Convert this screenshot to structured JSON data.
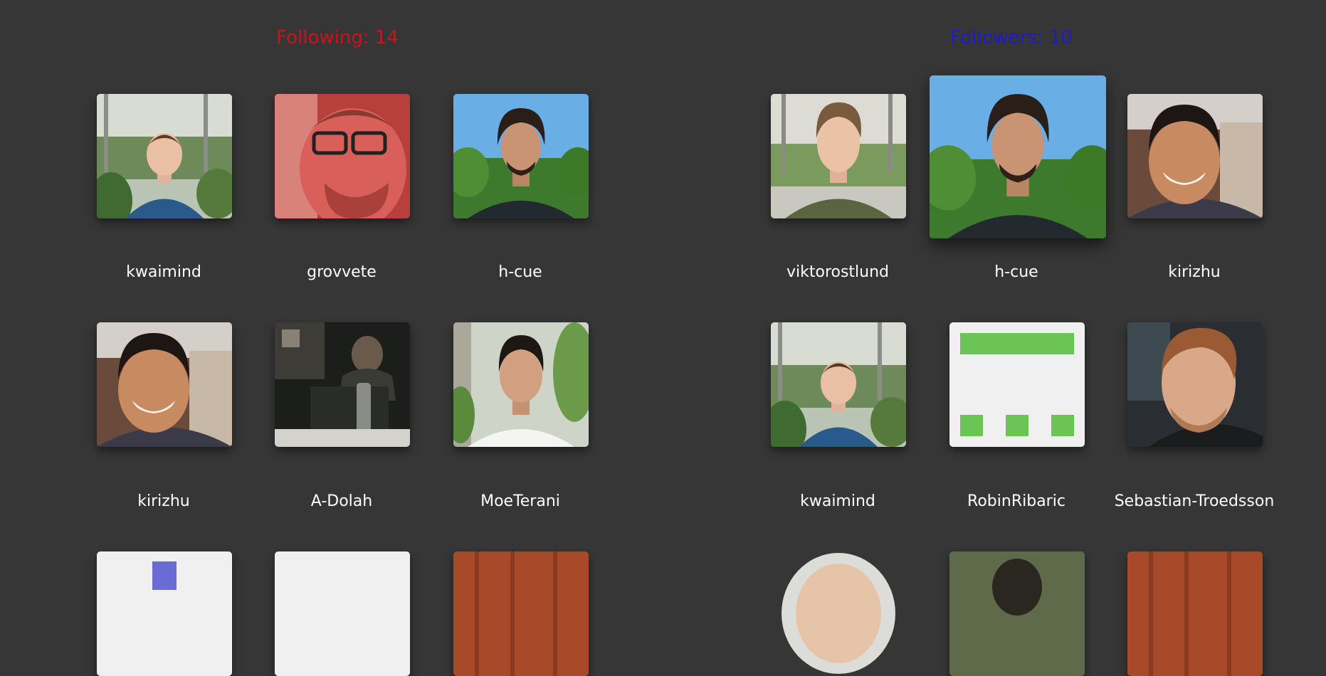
{
  "following": {
    "title": "Following: 14",
    "users": [
      {
        "username": "kwaimind",
        "avatar": "photo"
      },
      {
        "username": "grovvete",
        "avatar": "photo"
      },
      {
        "username": "h-cue",
        "avatar": "photo"
      },
      {
        "username": "kirizhu",
        "avatar": "photo"
      },
      {
        "username": "A-Dolah",
        "avatar": "photo"
      },
      {
        "username": "MoeTerani",
        "avatar": "photo"
      }
    ]
  },
  "followers": {
    "title": "Followers: 10",
    "users": [
      {
        "username": "viktorostlund",
        "avatar": "photo"
      },
      {
        "username": "h-cue",
        "avatar": "photo"
      },
      {
        "username": "kirizhu",
        "avatar": "photo"
      },
      {
        "username": "kwaimind",
        "avatar": "photo"
      },
      {
        "username": "RobinRibaric",
        "avatar": "identicon"
      },
      {
        "username": "Sebastian-Troedsson",
        "avatar": "photo"
      }
    ]
  },
  "colors": {
    "background": "#363636",
    "following_title": "#c8141a",
    "followers_title": "#1c1ccc",
    "username_text": "#ffffff",
    "identicon_green": "#6cc456",
    "identicon_purple": "#6b6bd6"
  }
}
